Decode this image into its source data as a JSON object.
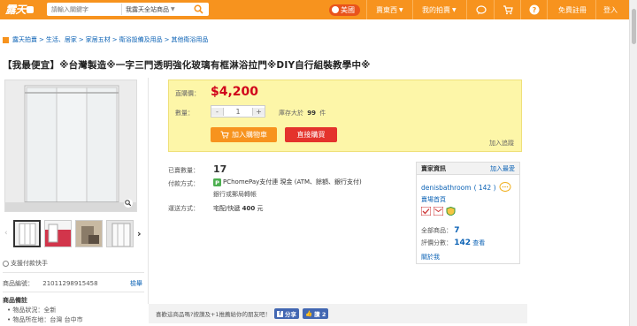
{
  "header": {
    "logo": "露天",
    "search_placeholder": "請輸入關鍵字",
    "search_scope": "我露天全站商品",
    "nav": {
      "region": "美國",
      "sell": "賣東西",
      "my_bids": "我的拍賣",
      "register": "免費註冊",
      "login": "登入"
    }
  },
  "breadcrumb": [
    "露天拍賣",
    "生活、居家",
    "家居五材",
    "衛浴設備及用品",
    "其他衛浴用品"
  ],
  "product": {
    "title": "【我最便宜】※台灣製造※一字三門透明強化玻璃有框淋浴拉門※DIY自行組裝教學中※",
    "price_label": "直購價：",
    "price": "$4,200",
    "qty_label": "數量：",
    "qty_minus": "-",
    "qty_value": "1",
    "qty_plus": "+",
    "stock_prefix": "庫存大於",
    "stock_num": "99",
    "stock_unit": "件",
    "add_cart": "加入購物車",
    "buy_now": "直接購買",
    "favorite": "加入追蹤",
    "sold_label": "已賣數量：",
    "sold": "17",
    "payment_label": "付款方式：",
    "payment_1": "PChomePay支付連 現金 (ATM、餘額、銀行支付)",
    "payment_2": "銀行或郵局轉帳",
    "shipping_label": "運送方式：",
    "shipping_prefix": "宅配/快遞",
    "shipping_price": "400",
    "shipping_unit": "元"
  },
  "left": {
    "quick_pay": "支援付款快手",
    "item_no_label": "商品編號：",
    "item_no": "21011298915458",
    "report": "檢舉",
    "notes_title": "商品備註",
    "condition_label": "物品狀況：",
    "condition": "全新",
    "location_label": "物品所在地：",
    "location": "台灣 台中市"
  },
  "seller": {
    "header": "賣家資訊",
    "follow": "加入最愛",
    "name": "denisbathroom",
    "score": "( 142 )",
    "store": "賣場首頁",
    "total_label": "全部商品：",
    "total": "7",
    "rating_label": "評價分數：",
    "rating": "142",
    "rating_link": "查看",
    "about": "關於我"
  },
  "share": {
    "text": "喜歡這商品嗎?按讚及+1推薦給你的朋友吧！",
    "fb_share": "分享",
    "fb_like": "讚 2"
  },
  "colors": {
    "topbar": "#f7931e",
    "price": "#d0021b",
    "link": "#0b62b5"
  }
}
